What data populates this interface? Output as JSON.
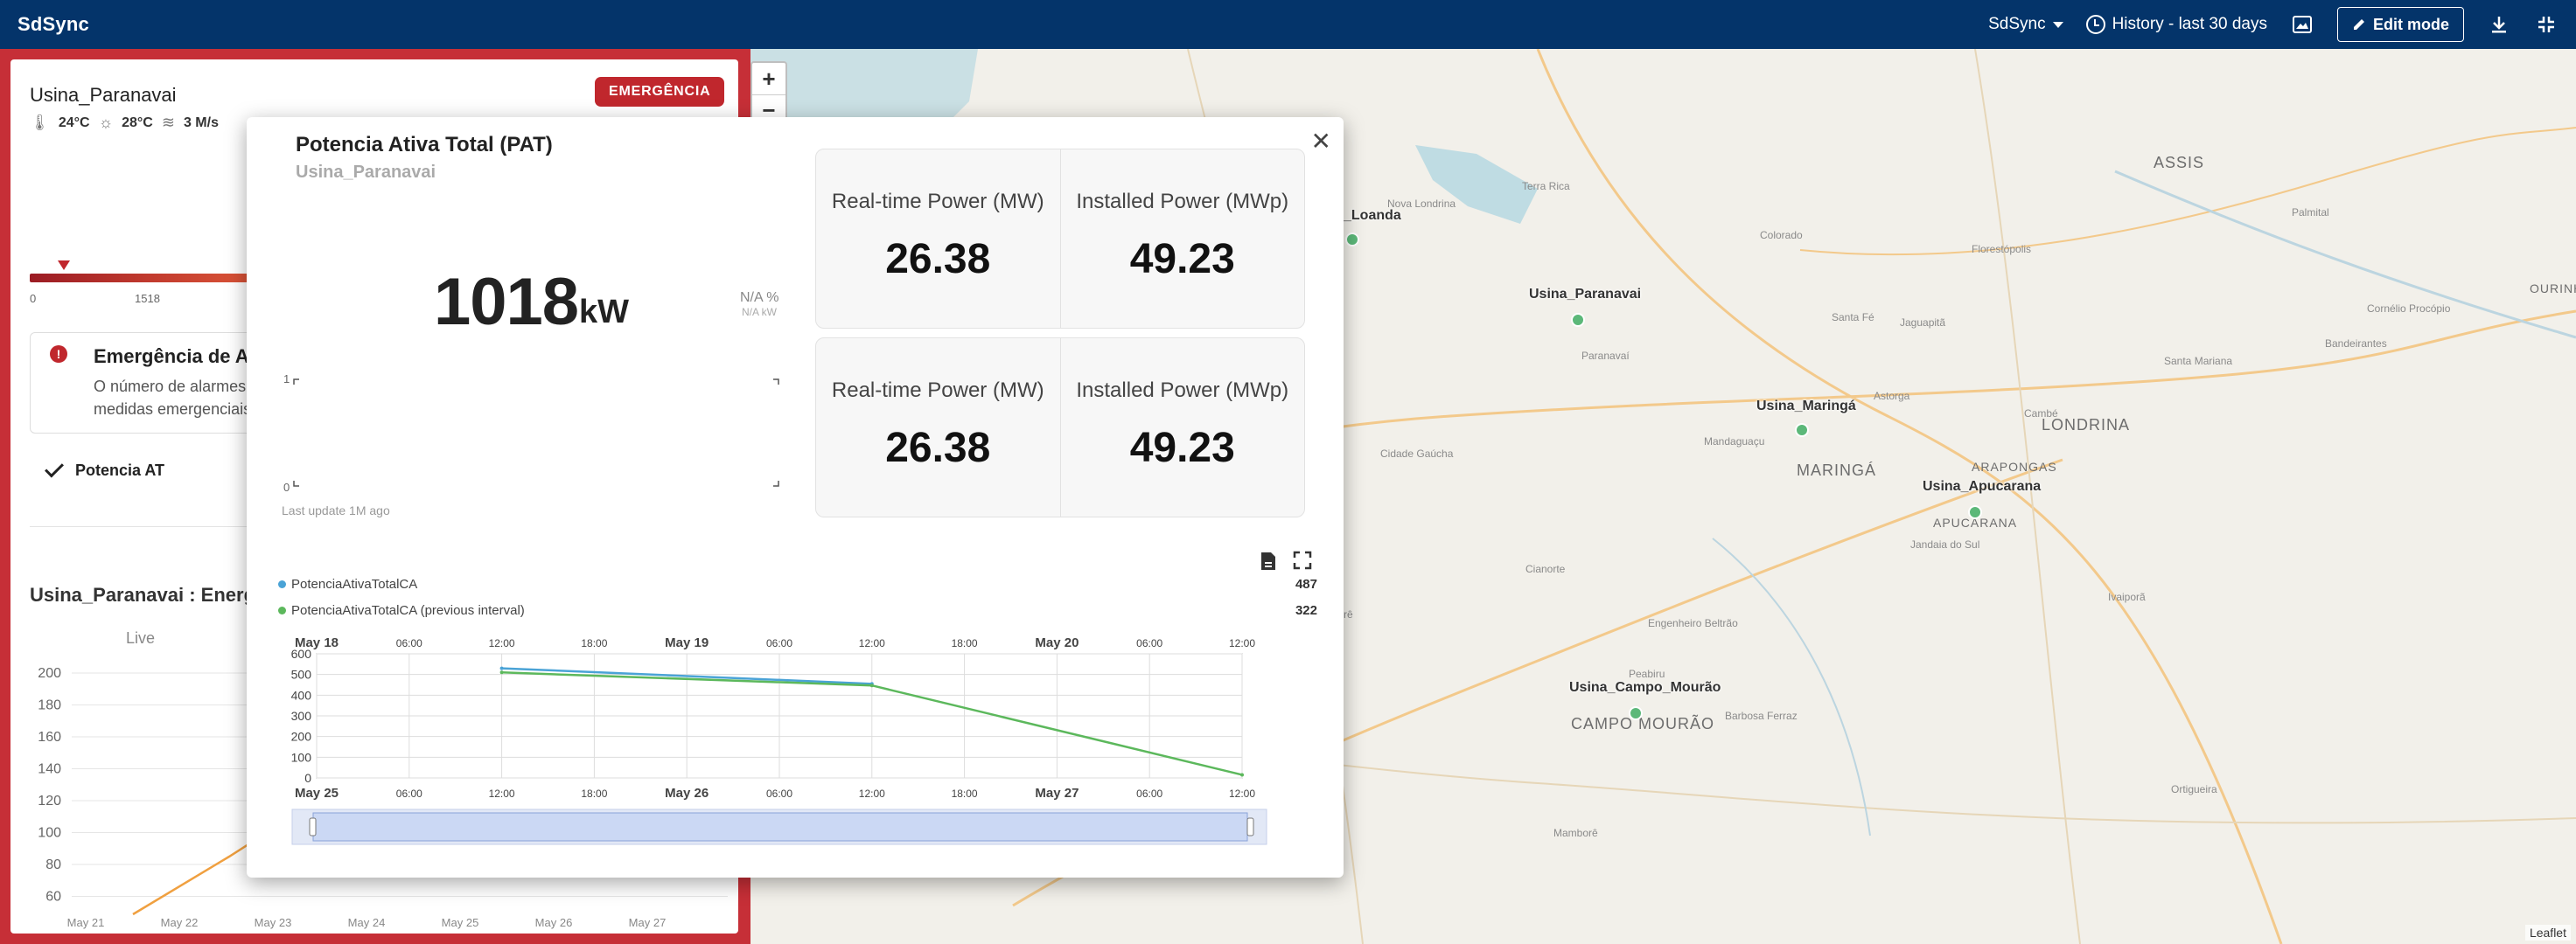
{
  "app": {
    "title": "SdSync"
  },
  "topbar": {
    "dashboard_select": "SdSync",
    "history": "History - last 30 days",
    "edit_mode": "Edit mode"
  },
  "left": {
    "title": "Usina_Paranavai",
    "badge": "EMERGÊNCIA",
    "weather": {
      "temp": "24°C",
      "feels": "28°C",
      "wind": "3 M/s"
    },
    "gauge_ticks": [
      "0",
      "1518"
    ],
    "alarm": {
      "title": "Emergência de Alar",
      "line1": "O número de alarmes ati",
      "line2": "medidas emergenciais de"
    },
    "check_label": "Potencia AT",
    "energy_title": "Usina_Paranavai : Energi",
    "live_label": "Live",
    "energy_y_ticks": [
      "200",
      "180",
      "160",
      "140",
      "120",
      "100",
      "80",
      "60"
    ],
    "energy_x_ticks": [
      "May 21",
      "May 22",
      "May 23",
      "May 24",
      "May 25",
      "May 26",
      "May 27"
    ]
  },
  "map": {
    "zoom_in": "+",
    "zoom_out": "−",
    "plants": [
      {
        "name": "_Loanda"
      },
      {
        "name": "Usina_Paranavai"
      },
      {
        "name": "Usina_Maringá"
      },
      {
        "name": "Usina_Apucarana"
      },
      {
        "name": "Usina_Campo_Mourão"
      }
    ],
    "cities": [
      "ASSIS",
      "LONDRINA",
      "MARINGÁ",
      "ARAPONGAS",
      "APUCARANA",
      "CAMPO MOURÃO",
      "OURINH"
    ],
    "towns": [
      "Colorado",
      "Nova Londrina",
      "Santa Fé",
      "Paranavaí",
      "Astorga",
      "Cambé",
      "Terra Rica",
      "Cidade Gaúcha",
      "Mandaguaçu",
      "Jandaia do Sul",
      "Ivaiporã",
      "Cianorte",
      "Goioerê",
      "Engenheiro Beltrão",
      "Peabiru",
      "Mamborê",
      "Barbosa Ferraz",
      "Ortigueira",
      "Jaguapitã",
      "Santa Mariana",
      "Cornélio Procópio",
      "Bandeirantes",
      "Palmital",
      "Florestópolis"
    ],
    "attribution": "Leaflet"
  },
  "popup": {
    "title": "Potencia Ativa Total (PAT)",
    "subtitle": "Usina_Paranavai",
    "value": "1018",
    "unit": "kW",
    "na_pct": "N/A %",
    "na_kw": "N/A kW",
    "spark_y_ticks": [
      "1",
      "0"
    ],
    "last_update": "Last update 1M ago",
    "kpis": [
      {
        "rt_label": "Real-time Power (MW)",
        "rt_value": "26.38",
        "inst_label": "Installed Power (MWp)",
        "inst_value": "49.23"
      },
      {
        "rt_label": "Real-time Power (MW)",
        "rt_value": "26.38",
        "inst_label": "Installed Power (MWp)",
        "inst_value": "49.23"
      }
    ],
    "legend": [
      {
        "name": "PotenciaAtivaTotalCA",
        "value": "487",
        "color": "#4aa3d6"
      },
      {
        "name": "PotenciaAtivaTotalCA (previous interval)",
        "value": "322",
        "color": "#5cb85c"
      }
    ]
  },
  "chart_data": {
    "type": "line",
    "title": "",
    "xlabel": "",
    "ylabel": "",
    "ylim": [
      0,
      600
    ],
    "y_ticks": [
      0,
      100,
      200,
      300,
      400,
      500,
      600
    ],
    "x_top_ticks": [
      "May 18",
      "06:00",
      "12:00",
      "18:00",
      "May 19",
      "06:00",
      "12:00",
      "18:00",
      "May 20",
      "06:00",
      "12:00"
    ],
    "x_bottom_ticks": [
      "May 25",
      "06:00",
      "12:00",
      "18:00",
      "May 26",
      "06:00",
      "12:00",
      "18:00",
      "May 27",
      "06:00",
      "12:00"
    ],
    "series": [
      {
        "name": "PotenciaAtivaTotalCA",
        "color": "#4aa3d6",
        "x": [
          "May 18 12:00",
          "May 19 12:00"
        ],
        "y": [
          530,
          455
        ]
      },
      {
        "name": "PotenciaAtivaTotalCA (previous interval)",
        "color": "#5cb85c",
        "x": [
          "May 18 12:00",
          "May 19 12:00",
          "May 20 12:00"
        ],
        "y": [
          510,
          447,
          15
        ]
      }
    ]
  }
}
